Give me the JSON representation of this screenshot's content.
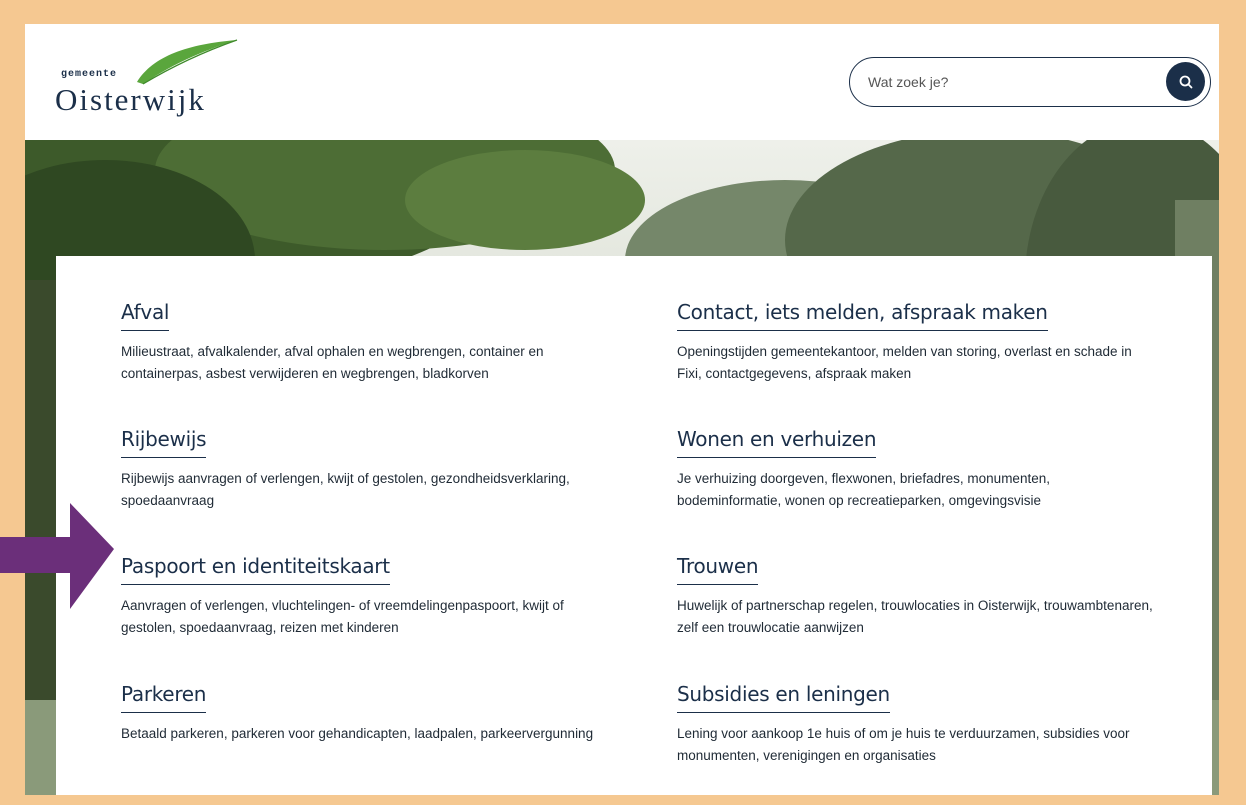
{
  "logo": {
    "small_text": "gemeente",
    "big_text": "Oisterwijk",
    "leaf_color": "#5aa63c"
  },
  "search": {
    "placeholder": "Wat zoek je?",
    "button_icon": "search-icon"
  },
  "annotation": {
    "arrow_icon": "arrow-right-icon",
    "color": "#6b2f7a"
  },
  "topics": [
    {
      "title": "Afval",
      "description": "Milieustraat, afvalkalender, afval ophalen en wegbrengen, container en containerpas, asbest verwijderen en wegbrengen, bladkorven"
    },
    {
      "title": "Contact, iets melden, afspraak maken",
      "description": "Openingstijden gemeentekantoor, melden van storing, overlast en schade in Fixi, contactgegevens, afspraak maken"
    },
    {
      "title": "Rijbewijs",
      "description": "Rijbewijs aanvragen of verlengen, kwijt of gestolen, gezondheidsverklaring, spoedaanvraag"
    },
    {
      "title": "Wonen en verhuizen",
      "description": "Je verhuizing doorgeven, flexwonen, briefadres, monumenten, bodeminformatie, wonen op recreatieparken, omgevingsvisie"
    },
    {
      "title": "Paspoort en identiteitskaart",
      "description": "Aanvragen of verlengen, vluchtelingen- of vreemdelingenpaspoort, kwijt of gestolen, spoedaanvraag, reizen met kinderen"
    },
    {
      "title": "Trouwen",
      "description": "Huwelijk of partnerschap regelen, trouwlocaties in Oisterwijk, trouwambtenaren, zelf een trouwlocatie aanwijzen"
    },
    {
      "title": "Parkeren",
      "description": "Betaald parkeren, parkeren voor gehandicapten, laadpalen, parkeervergunning"
    },
    {
      "title": "Subsidies en leningen",
      "description": "Lening voor aankoop 1e huis of om je huis te verduurzamen, subsidies voor monumenten, verenigingen en organisaties"
    }
  ]
}
